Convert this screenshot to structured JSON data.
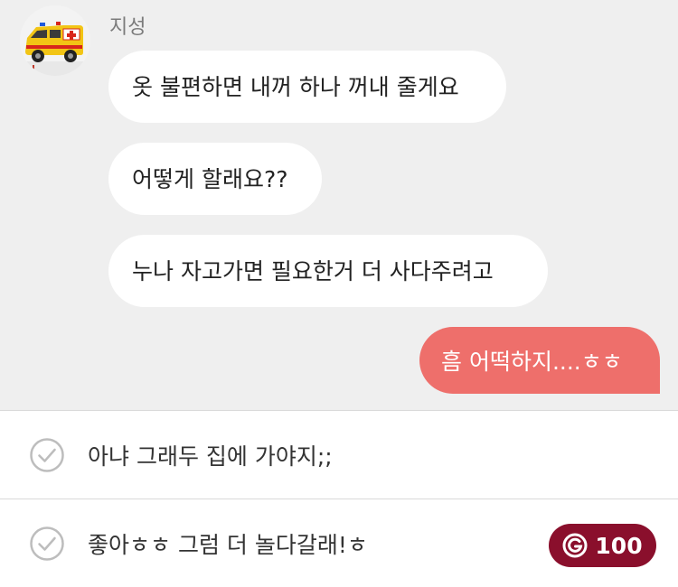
{
  "contact": {
    "name": "지성",
    "avatar_icon": "ambulance-toy-avatar"
  },
  "messages": [
    {
      "from": "other",
      "text": "옷 불편하면 내꺼 하나 꺼내 줄게요"
    },
    {
      "from": "other",
      "text": "어떻게 할래요??"
    },
    {
      "from": "other",
      "text": "누나 자고가면 필요한거 더 사다주려고"
    },
    {
      "from": "me",
      "text": "흠 어떡하지....ㅎㅎ"
    }
  ],
  "choices": [
    {
      "text": "아냐 그래두 집에 가야지;;",
      "icon": "check-circle-icon"
    },
    {
      "text": "좋아ㅎㅎ 그럼 더 놀다갈래!ㅎ",
      "icon": "check-circle-icon",
      "cost": "100",
      "cost_icon": "g-coin-icon"
    }
  ],
  "colors": {
    "chat_bg": "#efefef",
    "my_bubble": "#ee6f6b",
    "badge": "#8a0f2c"
  }
}
